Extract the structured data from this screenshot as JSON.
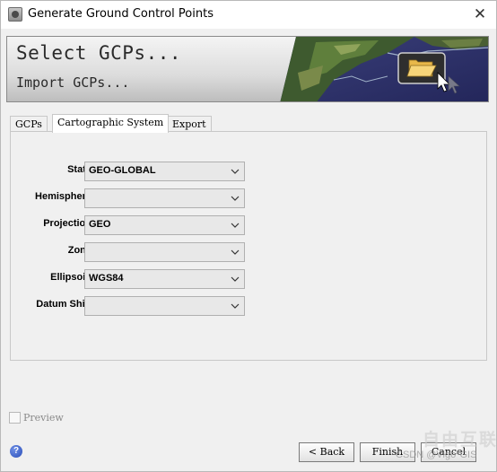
{
  "window": {
    "title": "Generate Ground Control Points",
    "close_glyph": "✕"
  },
  "banner": {
    "title": "Select GCPs...",
    "subtitle": "Import GCPs...",
    "image_icon": "open-folder-icon"
  },
  "tabs": [
    {
      "label": "GCPs",
      "active": false
    },
    {
      "label": "Cartographic System",
      "active": true
    },
    {
      "label": "Export",
      "active": false
    }
  ],
  "form": {
    "fields": [
      {
        "label": "State",
        "value": "GEO-GLOBAL"
      },
      {
        "label": "Hemisphere",
        "value": ""
      },
      {
        "label": "Projection",
        "value": "GEO"
      },
      {
        "label": "Zone",
        "value": ""
      },
      {
        "label": "Ellipsoid",
        "value": "WGS84"
      },
      {
        "label": "Datum Shift",
        "value": ""
      }
    ]
  },
  "preview": {
    "label": "Preview",
    "checked": false
  },
  "footer": {
    "help_glyph": "?",
    "back_label": "< Back",
    "finish_label": "Finish",
    "cancel_label": "Cancel"
  },
  "watermark": {
    "text": "自由互联",
    "sub": "CSDN @Vigo*GIS"
  },
  "colors": {
    "window_bg": "#f0f0f0",
    "combo_bg": "#e8e8e8",
    "help_blue": "#2c4fb8"
  }
}
